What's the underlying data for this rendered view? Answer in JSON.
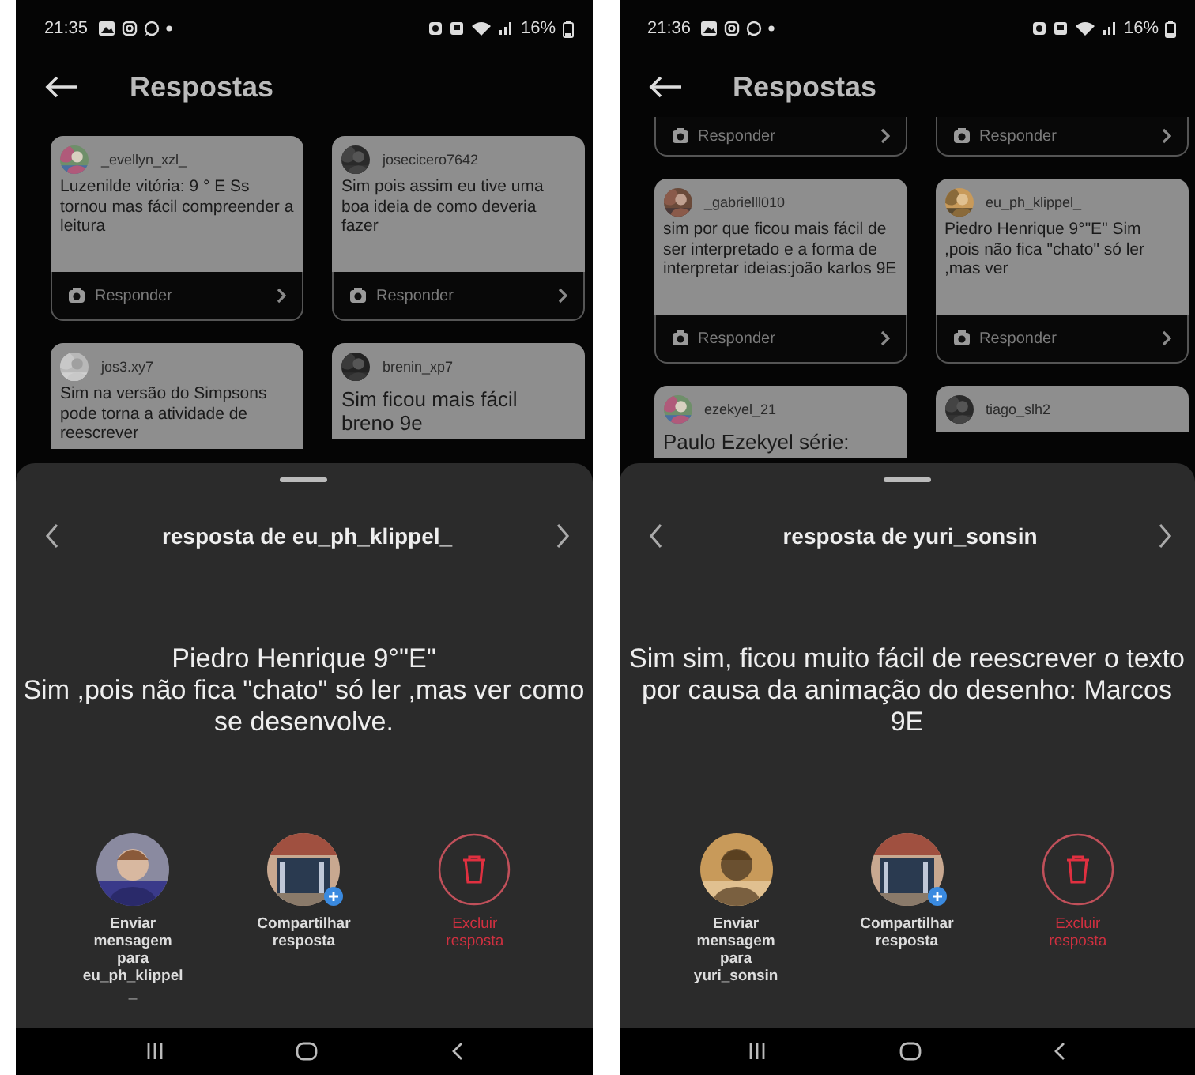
{
  "screens": [
    {
      "status_bar": {
        "time": "21:35",
        "battery": "16%"
      },
      "header": {
        "title": "Respostas"
      },
      "cards": [
        {
          "username": "_evellyn_xzl_",
          "text": "Luzenilde vitória: 9 ° E Ss tornou mas fácil compreender a leitura",
          "reply": "Responder"
        },
        {
          "username": "josecicero7642",
          "text": "Sim pois assim eu tive uma boa ideia de como deveria fazer",
          "reply": "Responder"
        },
        {
          "username": "jos3.xy7",
          "text": "Sim na versão do Simpsons pode torna a atividade de reescrever"
        },
        {
          "username": "brenin_xp7",
          "text": "Sim ficou mais fácil breno 9e"
        }
      ],
      "sheet": {
        "title": "resposta de eu_ph_klippel_",
        "body": "Piedro Henrique 9°\"E\"\nSim ,pois não fica \"chato\" só ler ,mas ver como se desenvolve.",
        "actions": [
          {
            "kind": "message",
            "label": "Enviar mensagem para eu_ph_klippel_"
          },
          {
            "kind": "share",
            "label": "Compartilhar resposta"
          },
          {
            "kind": "delete",
            "label": "Excluir resposta"
          }
        ]
      }
    },
    {
      "status_bar": {
        "time": "21:36",
        "battery": "16%"
      },
      "header": {
        "title": "Respostas"
      },
      "cards": [
        {
          "reply": "Responder"
        },
        {
          "reply": "Responder"
        },
        {
          "username": "_gabrielll010",
          "text": "sim por que ficou mais fácil de ser interpretado e a forma de interpretar ideias:joão karlos 9E",
          "reply": "Responder"
        },
        {
          "username": "eu_ph_klippel_",
          "text": "Piedro Henrique 9°\"E\" Sim ,pois não fica \"chato\" só ler ,mas ver",
          "reply": "Responder"
        },
        {
          "username": "ezekyel_21",
          "text": "Paulo Ezekyel série:"
        },
        {
          "username": "tiago_slh2"
        }
      ],
      "sheet": {
        "title": "resposta de yuri_sonsin",
        "body": "Sim sim, ficou muito fácil de reescrever o texto por causa da animação do desenho: Marcos   9E",
        "actions": [
          {
            "kind": "message",
            "label": "Enviar mensagem para yuri_sonsin"
          },
          {
            "kind": "share",
            "label": "Compartilhar resposta"
          },
          {
            "kind": "delete",
            "label": "Excluir resposta"
          }
        ]
      }
    }
  ]
}
